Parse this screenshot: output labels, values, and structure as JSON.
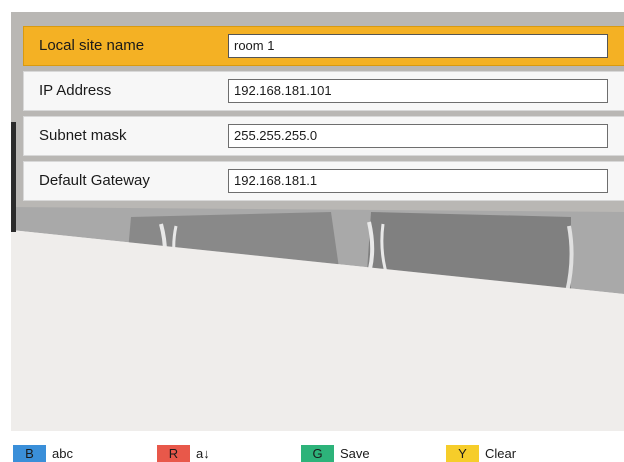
{
  "form": {
    "rows": [
      {
        "label": "Local site name",
        "value": "room 1",
        "selected": true
      },
      {
        "label": "IP Address",
        "value": "192.168.181.101",
        "selected": false
      },
      {
        "label": "Subnet mask",
        "value": "255.255.255.0",
        "selected": false
      },
      {
        "label": "Default Gateway",
        "value": "192.168.181.1",
        "selected": false
      }
    ]
  },
  "footer": {
    "keys": [
      {
        "key": "B",
        "label": "abc",
        "color": "#3a8fd9"
      },
      {
        "key": "R",
        "label": "a↓",
        "color": "#e8584a"
      },
      {
        "key": "G",
        "label": "Save",
        "color": "#2db37a"
      },
      {
        "key": "Y",
        "label": "Clear",
        "color": "#f6cd2a"
      }
    ]
  },
  "colors": {
    "selected_row": "#f4b124",
    "row_background": "#f7f7f7",
    "panel_background": "#efedeb"
  }
}
